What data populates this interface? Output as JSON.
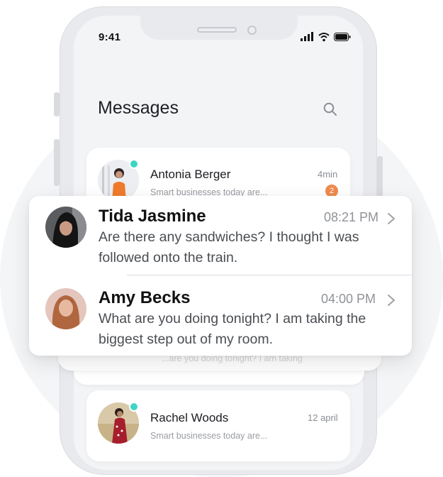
{
  "status_bar": {
    "time": "9:41"
  },
  "header": {
    "title": "Messages"
  },
  "conversations": [
    {
      "name": "Antonia Berger",
      "time": "4min",
      "preview": "Smart businesses today are...",
      "unread": "2",
      "online": true
    },
    {
      "name": "Rachel Woods",
      "time": "12 april",
      "preview": "Smart businesses today are...",
      "online": true
    }
  ],
  "hidden_preview": "...are you doing tonight? I am taking",
  "popup": {
    "rows": [
      {
        "name": "Tida Jasmine",
        "time": "08:21 PM",
        "message": "Are there any sandwiches? I thought I was followed onto the train."
      },
      {
        "name": "Amy Becks",
        "time": "04:00 PM",
        "message": "What are you doing tonight? I am taking the biggest step out of my room."
      }
    ]
  },
  "colors": {
    "online": "#3fd5c4",
    "badge": "#ef8a4d",
    "background": "#f4f5f7"
  }
}
